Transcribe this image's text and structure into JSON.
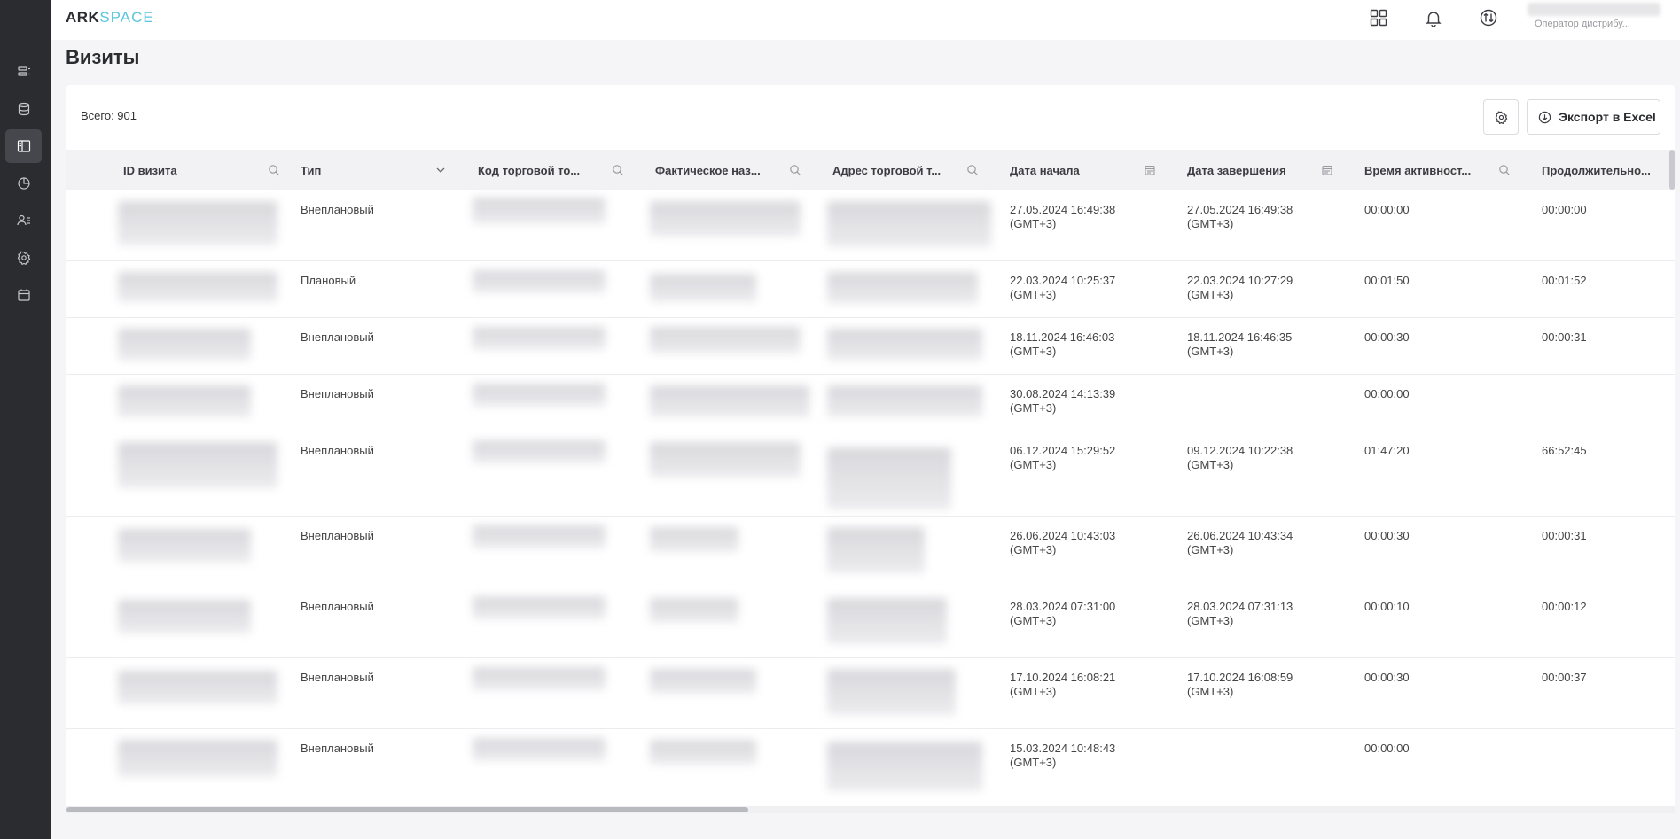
{
  "app": {
    "logo_part1": "ARK",
    "logo_part2": "SPACE",
    "accent_color": "#5bc6dd",
    "sidebar_color": "#2b2c30"
  },
  "sidebar": {
    "items": [
      {
        "icon": "layers-list-icon",
        "active": false
      },
      {
        "icon": "database-icon",
        "active": false
      },
      {
        "icon": "layout-panel-icon",
        "active": true
      },
      {
        "icon": "pie-chart-icon",
        "active": false
      },
      {
        "icon": "users-icon",
        "active": false
      },
      {
        "icon": "gear-icon",
        "active": false
      },
      {
        "icon": "calendar-icon",
        "active": false
      }
    ]
  },
  "header": {
    "icons": [
      "apps-grid-icon",
      "bell-icon",
      "swap-icon"
    ],
    "user_role": "Оператор дистрибу..."
  },
  "page": {
    "title": "Визиты",
    "total": "Всего: 901",
    "export_label": "Экспорт в Excel"
  },
  "table": {
    "columns": [
      {
        "label": "ID визита",
        "icon": "search-icon"
      },
      {
        "label": "Тип",
        "icon": "chevron-down-icon"
      },
      {
        "label": "Код торговой то...",
        "icon": "search-icon"
      },
      {
        "label": "Фактическое наз...",
        "icon": "search-icon"
      },
      {
        "label": "Адрес торговой т...",
        "icon": "search-icon"
      },
      {
        "label": "Дата начала",
        "icon": "calendar-icon"
      },
      {
        "label": "Дата завершения",
        "icon": "calendar-icon"
      },
      {
        "label": "Время активност...",
        "icon": "search-icon"
      },
      {
        "label": "Продолжительно...",
        "icon": ""
      }
    ],
    "rows": [
      {
        "type": "Внеплановый",
        "start": "27.05.2024 16:49:38",
        "start_tz": "(GMT+3)",
        "end": "27.05.2024 16:49:38",
        "end_tz": "(GMT+3)",
        "active": "00:00:00",
        "duration": "00:00:00"
      },
      {
        "type": "Плановый",
        "start": "22.03.2024 10:25:37",
        "start_tz": "(GMT+3)",
        "end": "22.03.2024 10:27:29",
        "end_tz": "(GMT+3)",
        "active": "00:01:50",
        "duration": "00:01:52"
      },
      {
        "type": "Внеплановый",
        "start": "18.11.2024 16:46:03",
        "start_tz": "(GMT+3)",
        "end": "18.11.2024 16:46:35",
        "end_tz": "(GMT+3)",
        "active": "00:00:30",
        "duration": "00:00:31"
      },
      {
        "type": "Внеплановый",
        "start": "30.08.2024 14:13:39",
        "start_tz": "(GMT+3)",
        "end": "",
        "end_tz": "",
        "active": "00:00:00",
        "duration": ""
      },
      {
        "type": "Внеплановый",
        "start": "06.12.2024 15:29:52",
        "start_tz": "(GMT+3)",
        "end": "09.12.2024 10:22:38",
        "end_tz": "(GMT+3)",
        "active": "01:47:20",
        "duration": "66:52:45"
      },
      {
        "type": "Внеплановый",
        "start": "26.06.2024 10:43:03",
        "start_tz": "(GMT+3)",
        "end": "26.06.2024 10:43:34",
        "end_tz": "(GMT+3)",
        "active": "00:00:30",
        "duration": "00:00:31"
      },
      {
        "type": "Внеплановый",
        "start": "28.03.2024 07:31:00",
        "start_tz": "(GMT+3)",
        "end": "28.03.2024 07:31:13",
        "end_tz": "(GMT+3)",
        "active": "00:00:10",
        "duration": "00:00:12"
      },
      {
        "type": "Внеплановый",
        "start": "17.10.2024 16:08:21",
        "start_tz": "(GMT+3)",
        "end": "17.10.2024 16:08:59",
        "end_tz": "(GMT+3)",
        "active": "00:00:30",
        "duration": "00:00:37"
      },
      {
        "type": "Внеплановый",
        "start": "15.03.2024 10:48:43",
        "start_tz": "(GMT+3)",
        "end": "",
        "end_tz": "",
        "active": "00:00:00",
        "duration": ""
      }
    ]
  }
}
